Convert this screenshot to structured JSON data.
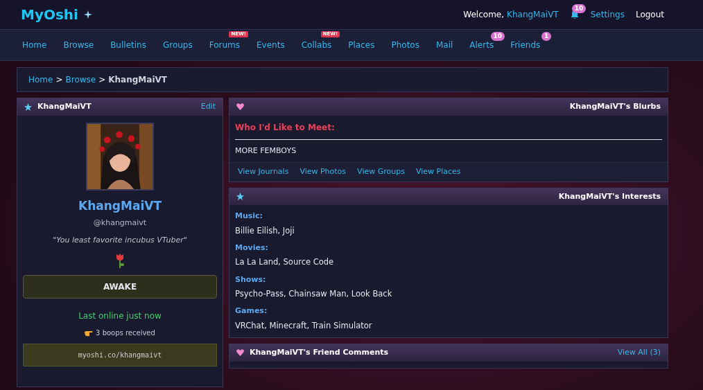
{
  "top_bar": {
    "logo": "MyOshi",
    "welcome": "Welcome,",
    "username": "KhangMaiVT",
    "alerts_count": "10",
    "links": [
      "Settings",
      "Logout"
    ]
  },
  "nav": [
    {
      "label": "Home"
    },
    {
      "label": "Browse"
    },
    {
      "label": "Bulletins"
    },
    {
      "label": "Groups"
    },
    {
      "label": "Forums",
      "badge": "NEW!",
      "kind": "new"
    },
    {
      "label": "Events"
    },
    {
      "label": "Collabs",
      "badge": "NEW!",
      "kind": "new"
    },
    {
      "label": "Places"
    },
    {
      "label": "Photos"
    },
    {
      "label": "Mail"
    },
    {
      "label": "Alerts",
      "badge": "10",
      "kind": "count"
    },
    {
      "label": "Friends",
      "badge": "1",
      "kind": "count"
    }
  ],
  "breadcrumb": {
    "items": [
      "Home",
      "Browse",
      "KhangMaiVT"
    ],
    "separator": ">"
  },
  "profile": {
    "title": "KhangMaiVT",
    "edit": "Edit",
    "display_name": "KhangMaiVT",
    "handle": "@khangmaivt",
    "quote": "\"You least favorite incubus VTuber\"",
    "status": "AWAKE",
    "last_online": "Last online just now",
    "boops": "3 boops received",
    "url": "myoshi.co/khangmaivt"
  },
  "blurbs": {
    "title": "KhangMaiVT's Blurbs",
    "sections": [
      {
        "heading": "Who I'd Like to Meet:",
        "text": "MORE FEMBOYS"
      }
    ],
    "links": [
      "View Journals",
      "View Photos",
      "View Groups",
      "View Places"
    ]
  },
  "interests": {
    "title": "KhangMaiVT's Interests",
    "items": [
      {
        "label": "Music:",
        "value": "Billie Eilish, Joji"
      },
      {
        "label": "Movies:",
        "value": "La La Land, Source Code"
      },
      {
        "label": "Shows:",
        "value": "Psycho-Pass, Chainsaw Man, Look Back"
      },
      {
        "label": "Games:",
        "value": "VRChat, Minecraft, Train Simulator"
      }
    ]
  },
  "comments": {
    "title": "KhangMaiVT's Friend Comments",
    "view_all": "View All (3)"
  }
}
